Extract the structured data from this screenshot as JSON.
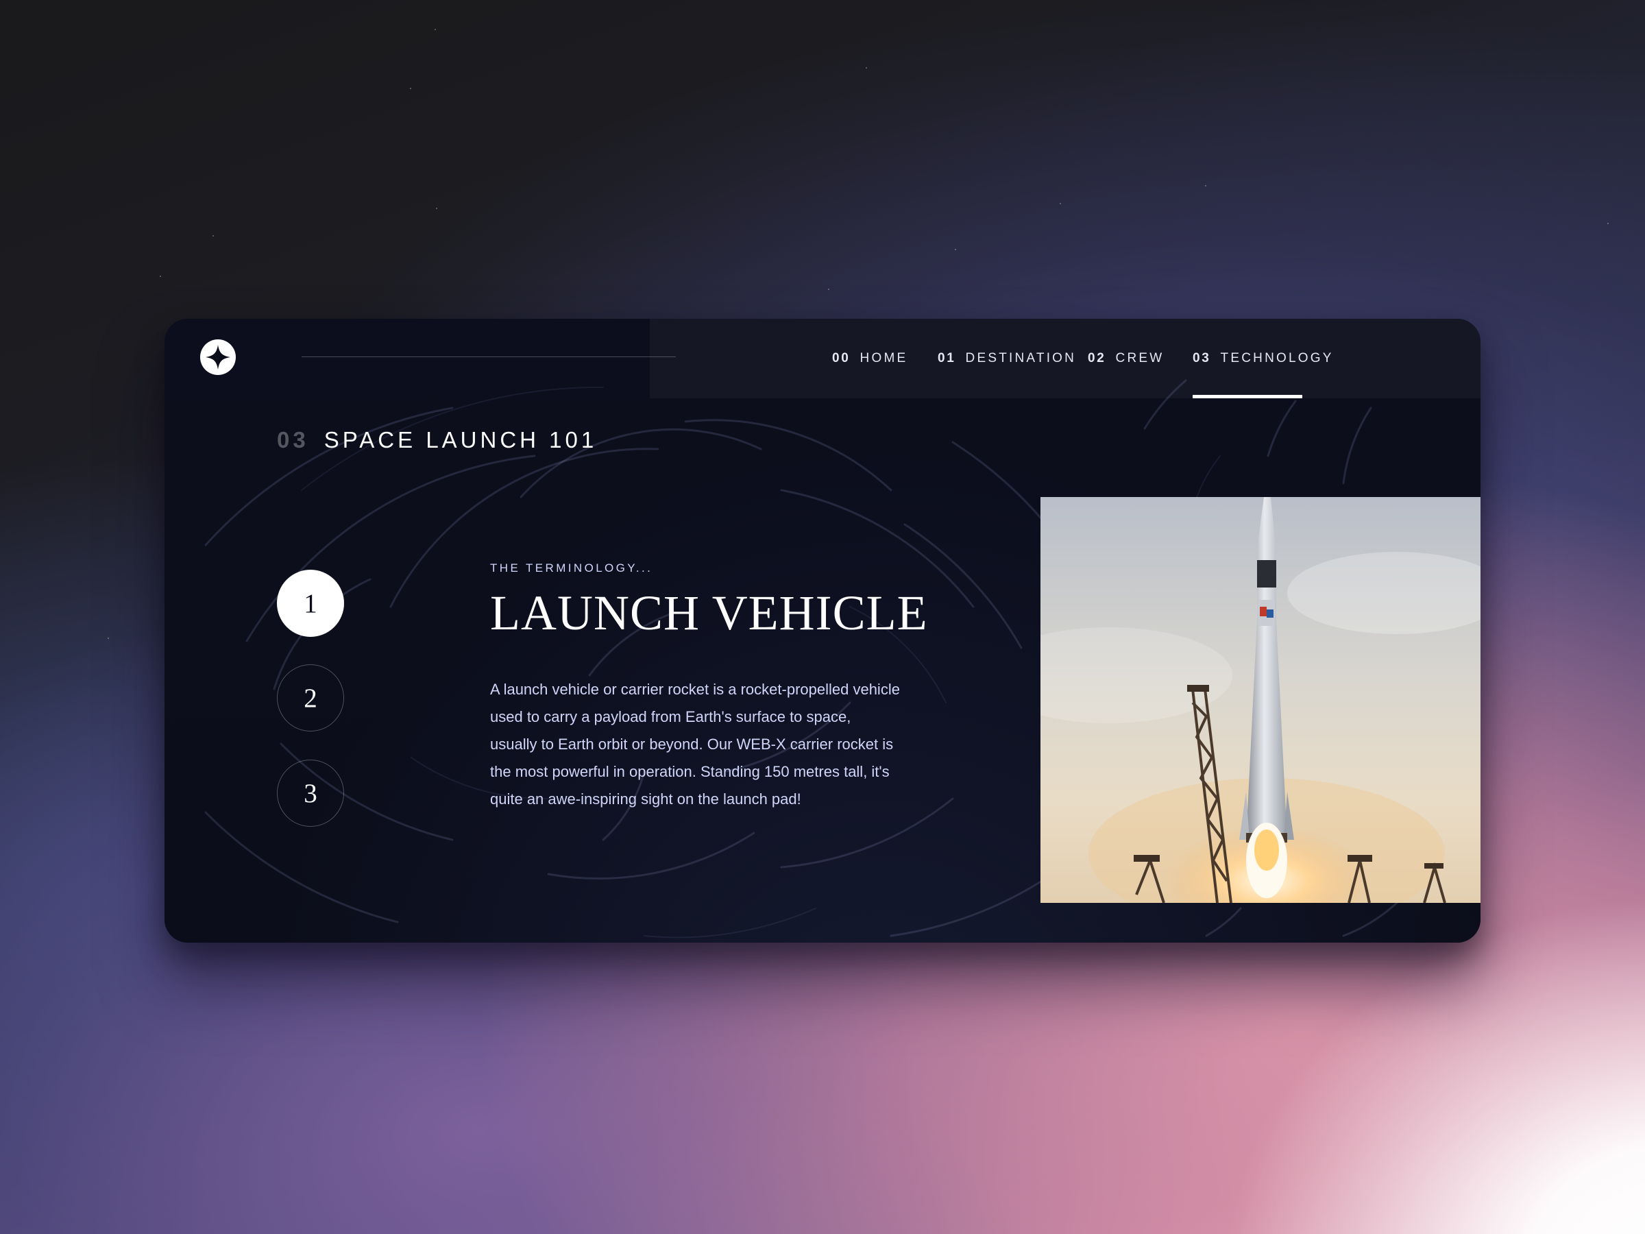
{
  "nav": {
    "items": [
      {
        "num": "00",
        "label": "HOME"
      },
      {
        "num": "01",
        "label": "DESTINATION"
      },
      {
        "num": "02",
        "label": "CREW"
      },
      {
        "num": "03",
        "label": "TECHNOLOGY"
      }
    ],
    "active_index": 3
  },
  "section": {
    "num": "03",
    "label": "SPACE LAUNCH 101"
  },
  "steps": [
    "1",
    "2",
    "3"
  ],
  "active_step": 0,
  "content": {
    "subhead": "THE TERMINOLOGY...",
    "title": "LAUNCH VEHICLE",
    "description": "A launch vehicle or carrier rocket is a rocket-propelled vehicle used to carry a payload from Earth's surface to space, usually to Earth orbit or beyond. Our WEB-X carrier rocket is the most powerful in operation. Standing 150 metres tall, it's quite an awe-inspiring sight on the launch pad!"
  },
  "colors": {
    "card_bg": "#0b0d1a",
    "accent_text": "#d0d6f9",
    "white": "#ffffff"
  },
  "icons": {
    "logo": "four-point-star-logo-icon"
  }
}
